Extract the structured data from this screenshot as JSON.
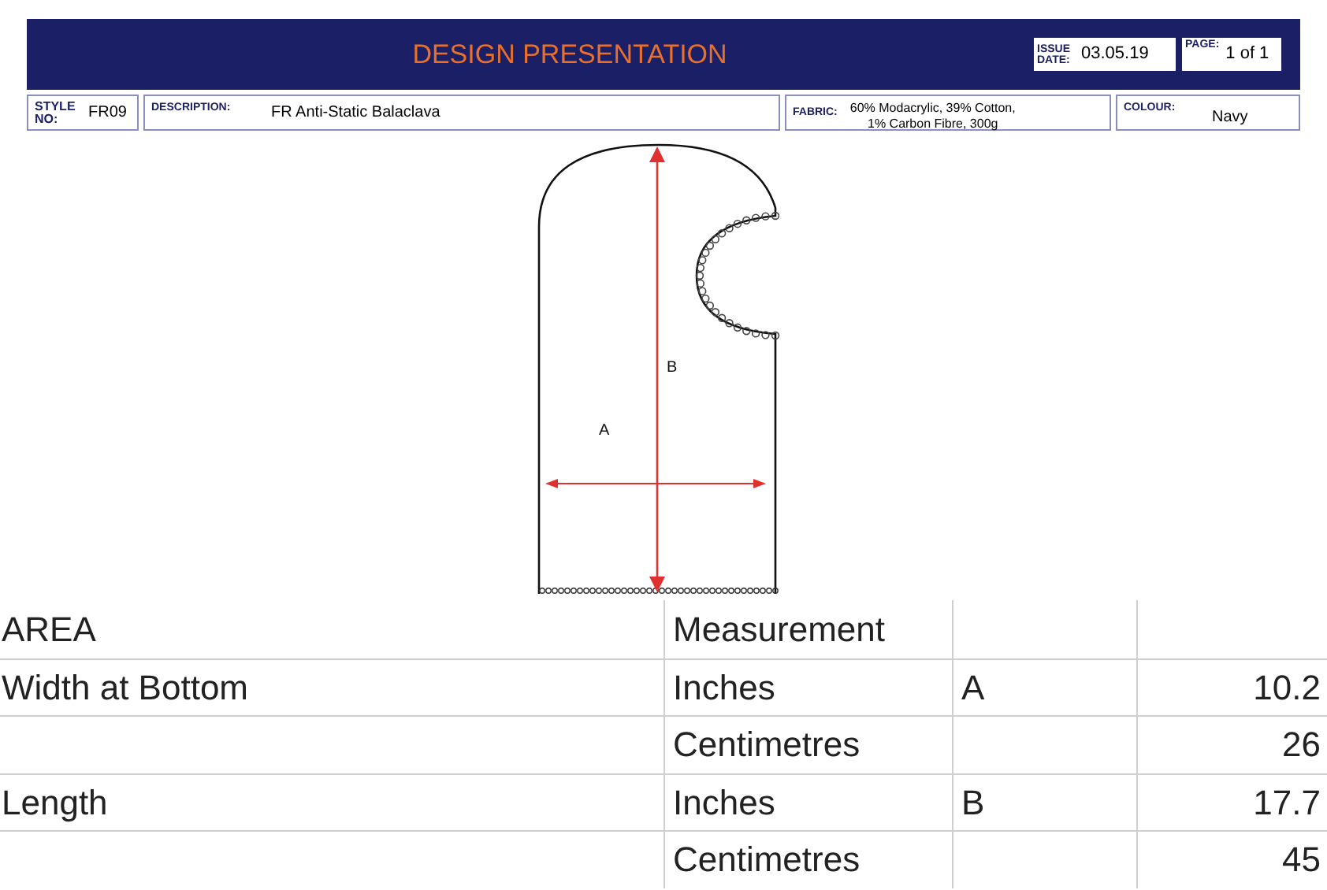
{
  "header": {
    "title": "DESIGN PRESENTATION",
    "issue_date": {
      "label": "ISSUE DATE:",
      "value": "03.05.19"
    },
    "page": {
      "label": "PAGE:",
      "value": "1 of 1"
    }
  },
  "info": {
    "style": {
      "label": "STYLE NO:",
      "value": "FR09"
    },
    "description": {
      "label": "DESCRIPTION:",
      "value": "FR Anti-Static Balaclava"
    },
    "fabric": {
      "label": "FABRIC:",
      "lines": [
        "60% Modacrylic, 39% Cotton,",
        "1% Carbon Fibre, 300g"
      ]
    },
    "colour": {
      "label": "COLOUR:",
      "value": "Navy"
    }
  },
  "drawing": {
    "labels": [
      "B",
      "A"
    ]
  },
  "table": {
    "rows": [
      {
        "area": "AREA",
        "unit": "Measurement",
        "point": "",
        "value": ""
      },
      {
        "area": "Width at Bottom",
        "unit": "Inches",
        "point": "A",
        "value": "10.2"
      },
      {
        "area": "",
        "unit": "Centimetres",
        "point": "",
        "value": "26"
      },
      {
        "area": "Length",
        "unit": "Inches",
        "point": "B",
        "value": "17.7"
      },
      {
        "area": "",
        "unit": "Centimetres",
        "point": "",
        "value": "45"
      }
    ]
  }
}
